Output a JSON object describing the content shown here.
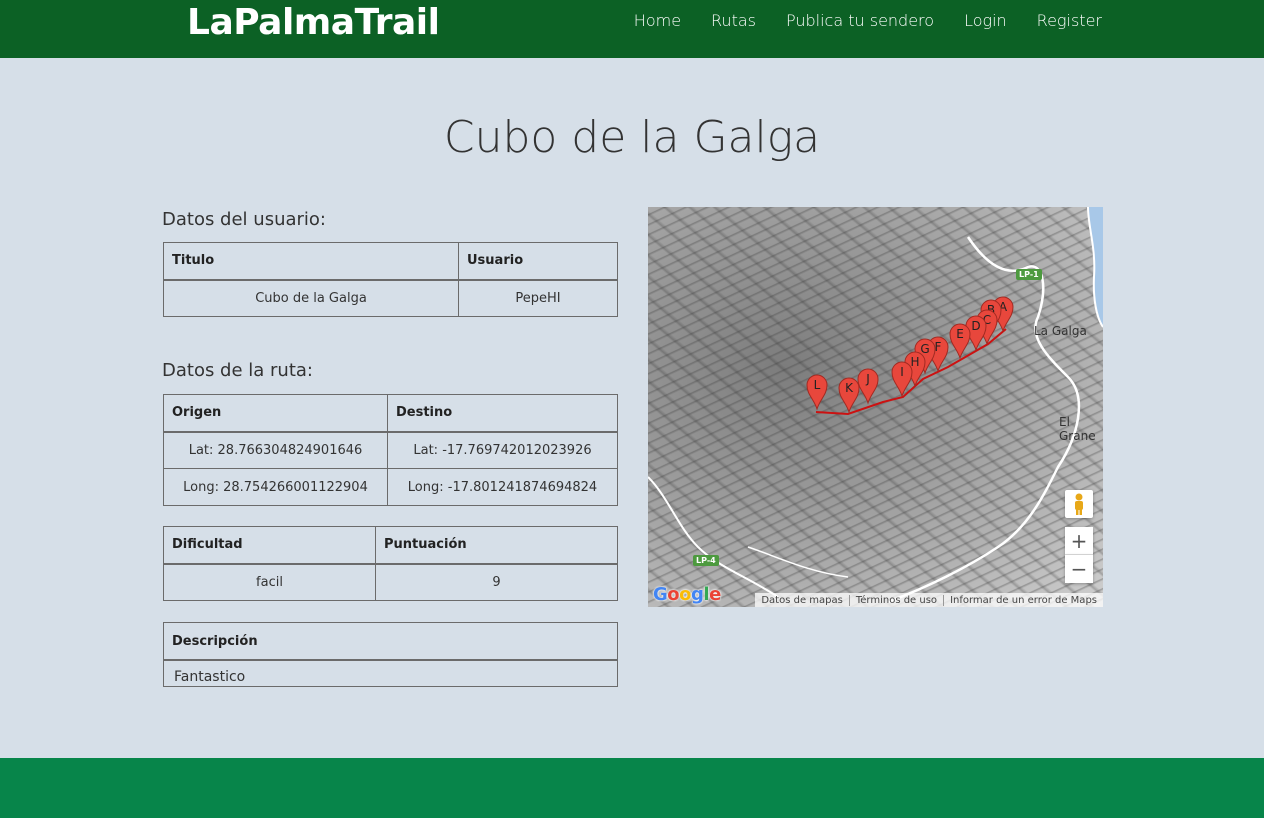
{
  "header": {
    "brand": "LaPalmaTrail",
    "nav": [
      "Home",
      "Rutas",
      "Publica tu sendero",
      "Login",
      "Register"
    ]
  },
  "page": {
    "title": "Cubo de la Galga"
  },
  "user_section": {
    "heading": "Datos del usuario:",
    "columns": [
      "Titulo",
      "Usuario"
    ],
    "row": [
      "Cubo de la Galga",
      "PepeHI"
    ]
  },
  "route_section": {
    "heading": "Datos de la ruta:",
    "columns": [
      "Origen",
      "Destino"
    ],
    "rows": [
      [
        "Lat: 28.766304824901646",
        "Lat: -17.769742012023926"
      ],
      [
        "Long: 28.754266001122904",
        "Long: -17.801241874694824"
      ]
    ]
  },
  "rating_table": {
    "columns": [
      "Dificultad",
      "Puntuación"
    ],
    "row": [
      "facil",
      "9"
    ]
  },
  "description": {
    "heading": "Descripción",
    "text": "Fantastico"
  },
  "map": {
    "place_labels": [
      "La Galga",
      "El Grane"
    ],
    "road_badges": [
      "LP-1",
      "LP-4"
    ],
    "marker_labels": [
      "A",
      "B",
      "C",
      "D",
      "E",
      "F",
      "G",
      "H",
      "I",
      "J",
      "K",
      "L"
    ],
    "logo": "Google",
    "footer_links": [
      "Datos de mapas",
      "Términos de uso",
      "Informar de un error de Maps"
    ],
    "zoom_in": "+",
    "zoom_out": "−",
    "marker_color": "#e8473c",
    "route_color": "#cc1111"
  }
}
